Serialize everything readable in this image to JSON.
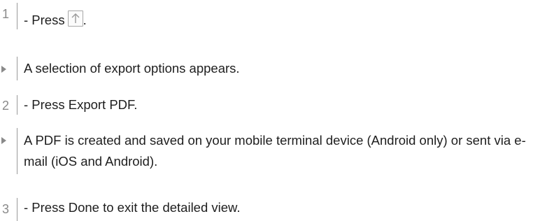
{
  "steps": [
    {
      "kind": "number",
      "marker": "1",
      "before": "- Press",
      "after": "."
    },
    {
      "kind": "result",
      "text": "A selection of export options appears."
    },
    {
      "kind": "number",
      "marker": "2",
      "text": "- Press Export PDF."
    },
    {
      "kind": "result",
      "text": "A PDF is created and saved on your mobile terminal device (Android only) or sent via e-mail (iOS and Android)."
    },
    {
      "kind": "number",
      "marker": "3",
      "text": "- Press Done to exit the detailed view."
    }
  ],
  "icons": {
    "share": "arrow-up-icon",
    "result": "result-arrow-icon"
  },
  "colors": {
    "marker": "#8a8a8a",
    "text": "#1e1e1e",
    "rule": "#9a9a9a"
  }
}
